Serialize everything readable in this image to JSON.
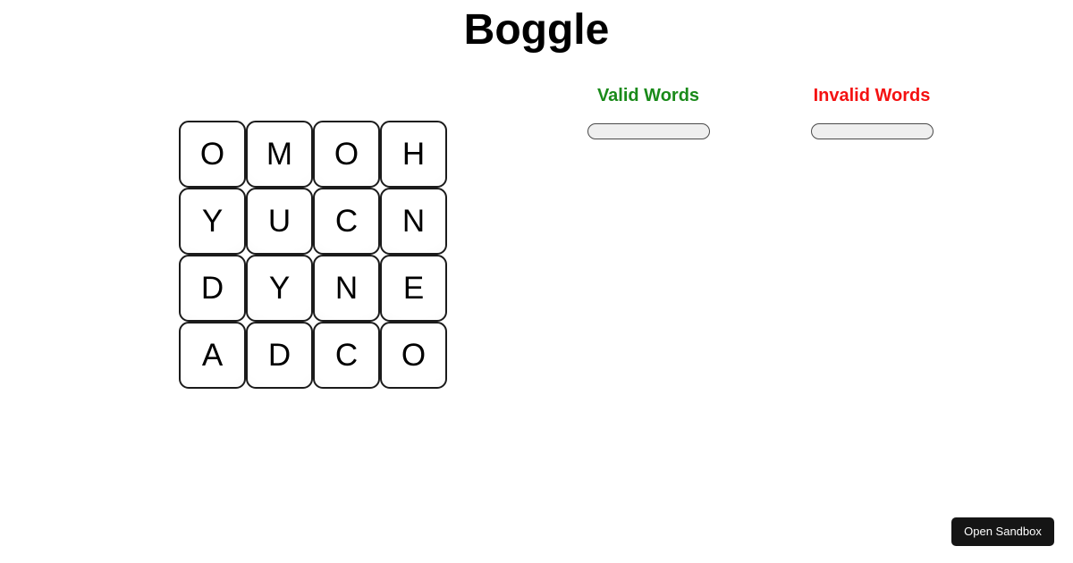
{
  "app": {
    "title": "Boggle"
  },
  "board": {
    "rows": 4,
    "cols": 4,
    "letters": [
      [
        "O",
        "M",
        "O",
        "H"
      ],
      [
        "Y",
        "U",
        "C",
        "N"
      ],
      [
        "D",
        "Y",
        "N",
        "E"
      ],
      [
        "A",
        "D",
        "C",
        "O"
      ]
    ],
    "flat": [
      "O",
      "M",
      "O",
      "H",
      "Y",
      "U",
      "C",
      "N",
      "D",
      "Y",
      "N",
      "E",
      "A",
      "D",
      "C",
      "O"
    ]
  },
  "panels": {
    "valid": {
      "heading": "Valid Words",
      "heading_color": "#1a8a1a",
      "words": "",
      "placeholder": ""
    },
    "invalid": {
      "heading": "Invalid Words",
      "heading_color": "#f41111",
      "words": "",
      "placeholder": ""
    }
  },
  "sandbox": {
    "label": "Open Sandbox"
  }
}
